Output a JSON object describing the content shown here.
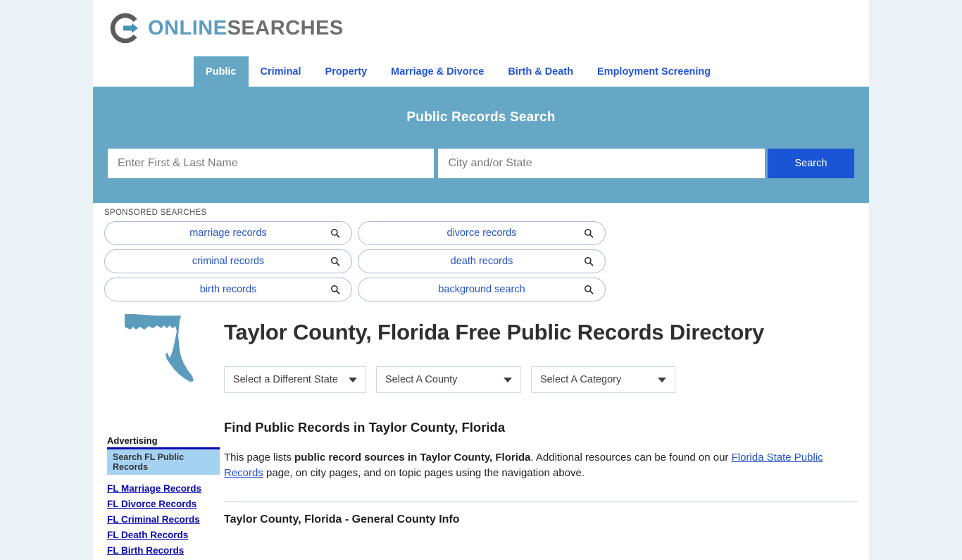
{
  "site": {
    "logo_primary": "ONLINE",
    "logo_secondary": "SEARCHES",
    "logo_icon": "circle-arrow-logo-icon"
  },
  "nav": {
    "items": [
      {
        "label": "Public",
        "active": true
      },
      {
        "label": "Criminal",
        "active": false
      },
      {
        "label": "Property",
        "active": false
      },
      {
        "label": "Marriage & Divorce",
        "active": false
      },
      {
        "label": "Birth & Death",
        "active": false
      },
      {
        "label": "Employment Screening",
        "active": false
      }
    ]
  },
  "hero": {
    "title": "Public Records Search",
    "name_value": "",
    "name_placeholder": "Enter First & Last Name",
    "location_value": "",
    "location_placeholder": "City and/or State",
    "search_label": "Search",
    "background_color": "#66a7c5",
    "button_color": "#1a55d6"
  },
  "sponsored": {
    "label": "SPONSORED SEARCHES",
    "items": [
      "marriage records",
      "divorce records",
      "criminal records",
      "death records",
      "birth records",
      "background search"
    ]
  },
  "sidebar": {
    "map_icon": "florida-state-map-icon",
    "map_color": "#5b9cbc",
    "ads_title": "Advertising",
    "ads_highlight": "Search FL Public Records",
    "ads_links": [
      "FL Marriage Records",
      "FL Divorce Records",
      "FL Criminal Records",
      "FL Death Records",
      "FL Birth Records"
    ]
  },
  "main": {
    "page_title": "Taylor County, Florida Free Public Records Directory",
    "selects": {
      "state": "Select a Different State",
      "county": "Select A County",
      "category": "Select A Category"
    },
    "section_heading": "Find Public Records in Taylor County, Florida",
    "paragraph": {
      "part1": "This page lists ",
      "bold1": "public record sources in Taylor County, Florida",
      "part2": ". Additional resources can be found on our ",
      "link": "Florida State Public Records",
      "part3": " page, on city pages, and on topic pages using the navigation above."
    },
    "subsection_heading": "Taylor County, Florida - General County Info"
  }
}
